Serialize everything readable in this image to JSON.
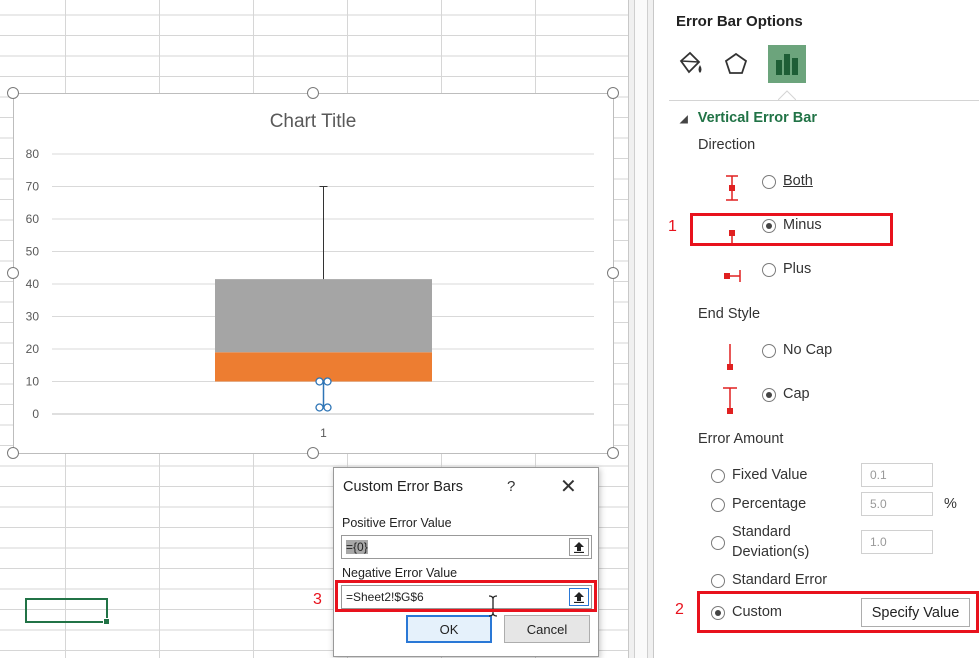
{
  "chart": {
    "title": "Chart Title",
    "y_ticks": [
      "80",
      "70",
      "60",
      "50",
      "40",
      "30",
      "20",
      "10",
      "0"
    ],
    "x_tick": "1"
  },
  "chart_data": {
    "type": "bar",
    "stacked": true,
    "title": "Chart Title",
    "categories": [
      "1"
    ],
    "ylim": [
      0,
      80
    ],
    "y_ticks": [
      0,
      10,
      20,
      30,
      40,
      50,
      60,
      70,
      80
    ],
    "grid": true,
    "series": [
      {
        "values": [
          10
        ],
        "color": "#ffffff",
        "invisible": true
      },
      {
        "values": [
          9
        ],
        "color": "#ed7d31"
      },
      {
        "values": [
          22.5
        ],
        "color": "#a5a5a5"
      }
    ],
    "error_bars": [
      {
        "at_category": "1",
        "from": 41.5,
        "to": 70,
        "kind": "plus"
      },
      {
        "at_category": "1",
        "from": 10,
        "to": 2,
        "kind": "custom-selected"
      }
    ]
  },
  "panel": {
    "title": "Error Bar Options",
    "section": "Vertical Error Bar",
    "direction_label": "Direction",
    "direction": [
      {
        "label": "Both",
        "selected": false
      },
      {
        "label": "Minus",
        "selected": true
      },
      {
        "label": "Plus",
        "selected": false
      }
    ],
    "end_style_label": "End Style",
    "end_style": [
      {
        "label": "No Cap",
        "selected": false
      },
      {
        "label": "Cap",
        "selected": true
      }
    ],
    "error_amount_label": "Error Amount",
    "error_amount": {
      "fixed": {
        "label": "Fixed Value",
        "value": "0.1"
      },
      "percentage": {
        "label": "Percentage",
        "value": "5.0",
        "unit": "%"
      },
      "stddev": {
        "label_line1": "Standard",
        "label_line2": "Deviation(s)",
        "value": "1.0"
      },
      "stderr": {
        "label": "Standard Error"
      },
      "custom": {
        "label": "Custom",
        "button": "Specify Value"
      }
    }
  },
  "dialog": {
    "title": "Custom Error Bars",
    "help": "?",
    "close": "✕",
    "positive_label": "Positive Error Value",
    "positive_value": "={0}",
    "negative_label": "Negative Error Value",
    "negative_value": "=Sheet2!$G$6",
    "ok": "OK",
    "cancel": "Cancel"
  },
  "annotations": [
    "1",
    "2",
    "3"
  ],
  "colors": {
    "accent_green": "#217346",
    "highlight_red": "#e8121d",
    "orange": "#ed7d31",
    "gray": "#a5a5a5",
    "error_red": "#e02020"
  }
}
